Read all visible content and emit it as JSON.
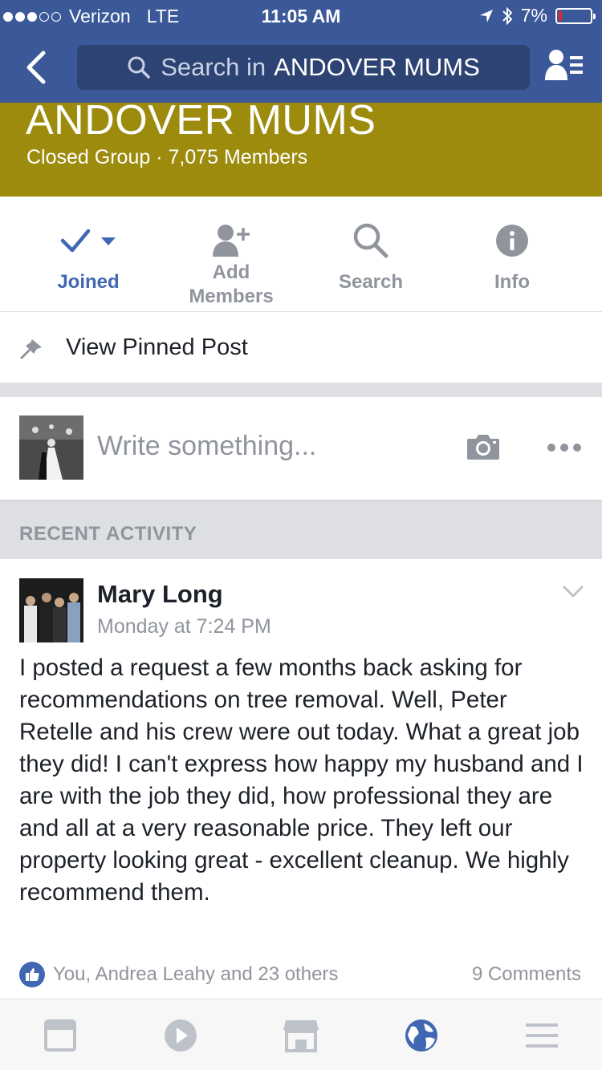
{
  "status_bar": {
    "carrier": "Verizon",
    "network": "LTE",
    "time": "11:05 AM",
    "battery": "7%",
    "battery_level": 0.07
  },
  "nav": {
    "search_placeholder": "Search in",
    "search_group": "ANDOVER MUMS"
  },
  "group": {
    "name": "ANDOVER MUMS",
    "subtitle": "Closed Group · 7,075 Members",
    "cover_color": "#9c8b0c"
  },
  "actions": [
    {
      "label": "Joined",
      "icon": "checkmark-icon"
    },
    {
      "label": "Add Members",
      "label_line1": "Add",
      "label_line2": "Members",
      "icon": "add-person-icon"
    },
    {
      "label": "Search",
      "icon": "search-icon"
    },
    {
      "label": "Info",
      "icon": "info-icon"
    }
  ],
  "pinned": {
    "label": "View Pinned Post"
  },
  "composer": {
    "placeholder": "Write something..."
  },
  "recent_activity_label": "RECENT ACTIVITY",
  "post": {
    "author": "Mary Long",
    "time": "Monday at 7:24 PM",
    "text": "I posted a request a few months back asking for recommendations on tree removal.  Well, Peter Retelle and his crew were out today.  What a great job they did! I can't express how happy my husband and I are with the job they did, how professional they are and all at a very reasonable price.  They left our property looking great - excellent cleanup.  We highly recommend them.",
    "reactions": "You, Andrea Leahy and 23 others",
    "comments": "9 Comments"
  },
  "tabs": [
    {
      "icon": "news-feed-icon"
    },
    {
      "icon": "video-icon"
    },
    {
      "icon": "marketplace-icon"
    },
    {
      "icon": "globe-icon",
      "active": true
    },
    {
      "icon": "menu-icon"
    }
  ],
  "colors": {
    "brand_blue": "#3b5998",
    "accent_blue": "#4267b2",
    "gray_text": "#90949c"
  }
}
